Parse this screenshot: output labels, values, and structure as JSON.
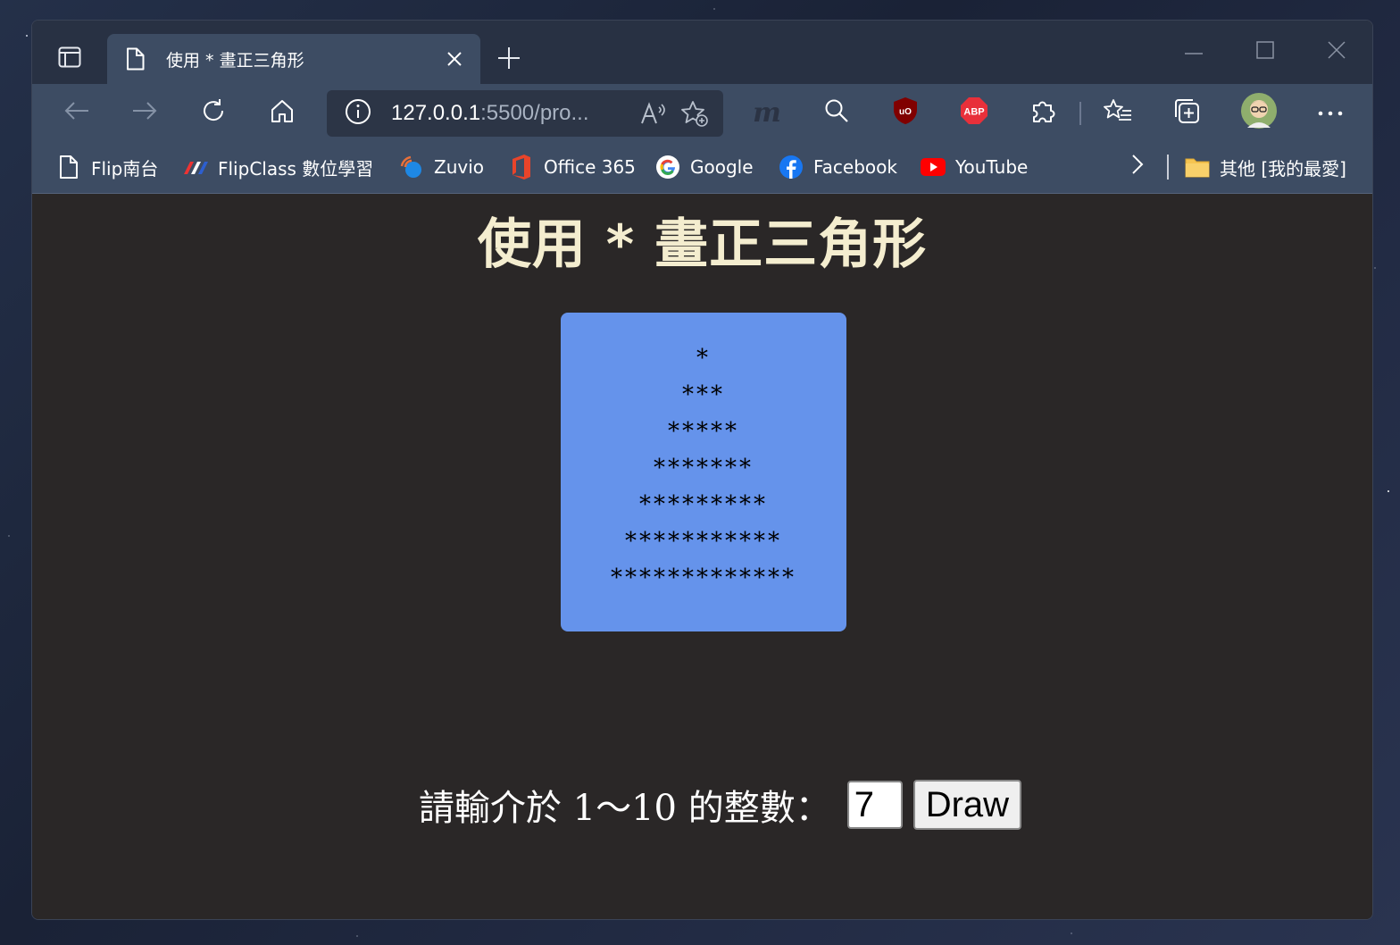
{
  "browser": {
    "tab": {
      "title": "使用 * 畫正三角形"
    },
    "address": {
      "url_main": "127.0.0.1",
      "url_rest": ":5500/pro..."
    },
    "bookmarks": [
      {
        "label": "Flip南台",
        "icon": "page-icon"
      },
      {
        "label": "FlipClass 數位學習",
        "icon": "flipclass-icon"
      },
      {
        "label": "Zuvio",
        "icon": "zuvio-icon"
      },
      {
        "label": "Office 365",
        "icon": "office-icon"
      },
      {
        "label": "Google",
        "icon": "google-icon"
      },
      {
        "label": "Facebook",
        "icon": "facebook-icon"
      },
      {
        "label": "YouTube",
        "icon": "youtube-icon"
      }
    ],
    "other_favorites": "其他 [我的最愛]",
    "extensions": {
      "ublock": "uO",
      "abp": "ABP"
    }
  },
  "page": {
    "title": "使用 * 畫正三角形",
    "triangle_rows": [
      "*",
      "***",
      "*****",
      "*******",
      "*********",
      "***********",
      "*************"
    ],
    "prompt_label": "請輸介於 1～10 的整數：",
    "input_value": "7",
    "draw_button": "Draw"
  },
  "colors": {
    "page_bg": "#2a2727",
    "title_color": "#f4edcf",
    "triangle_box": "#6593eb",
    "chrome_toolbar": "#3d4c63"
  }
}
